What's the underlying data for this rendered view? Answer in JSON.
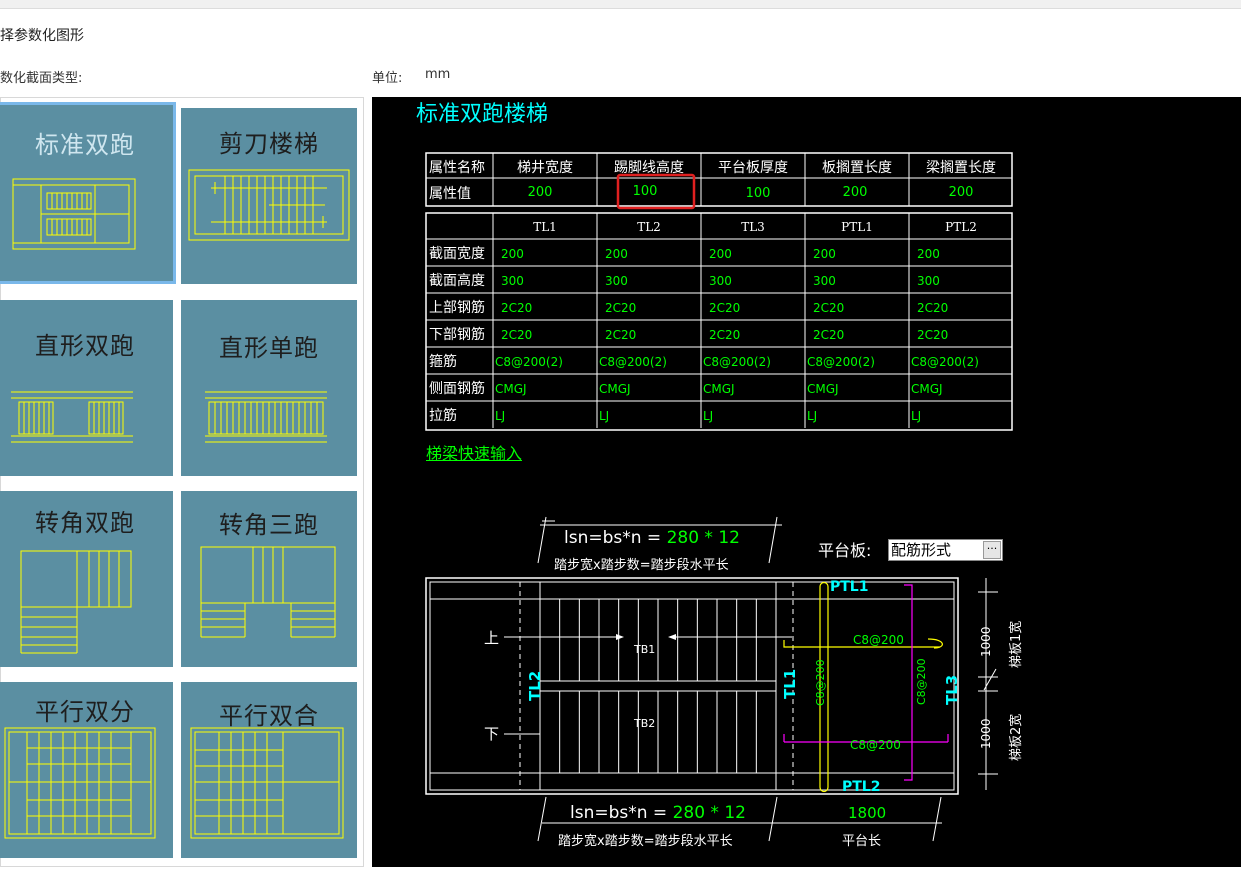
{
  "dialog": {
    "title": "择参数化图形",
    "section_label": "数化截面类型:",
    "unit_label": "单位:",
    "unit_value": "mm"
  },
  "types": [
    {
      "label": "标准双跑",
      "selected": true
    },
    {
      "label": "剪刀楼梯",
      "selected": false
    },
    {
      "label": "直形双跑",
      "selected": false
    },
    {
      "label": "直形单跑",
      "selected": false
    },
    {
      "label": "转角双跑",
      "selected": false
    },
    {
      "label": "转角三跑",
      "selected": false
    },
    {
      "label": "平行双分",
      "selected": false
    },
    {
      "label": "平行双合",
      "selected": false
    }
  ],
  "preview": {
    "title": "标准双跑楼梯",
    "params_table": {
      "row_headers": [
        "属性名称",
        "属性值"
      ],
      "columns": [
        "梯井宽度",
        "踢脚线高度",
        "平台板厚度",
        "板搁置长度",
        "梁搁置长度"
      ],
      "values": [
        "200",
        "100",
        "100",
        "200",
        "200"
      ],
      "highlighted_col": 1
    },
    "beam_table": {
      "columns": [
        "TL1",
        "TL2",
        "TL3",
        "PTL1",
        "PTL2"
      ],
      "rows": [
        {
          "label": "截面宽度",
          "values": [
            "200",
            "200",
            "200",
            "200",
            "200"
          ]
        },
        {
          "label": "截面高度",
          "values": [
            "300",
            "300",
            "300",
            "300",
            "300"
          ]
        },
        {
          "label": "上部钢筋",
          "values": [
            "2C20",
            "2C20",
            "2C20",
            "2C20",
            "2C20"
          ]
        },
        {
          "label": "下部钢筋",
          "values": [
            "2C20",
            "2C20",
            "2C20",
            "2C20",
            "2C20"
          ]
        },
        {
          "label": "箍筋",
          "values": [
            "C8@200(2)",
            "C8@200(2)",
            "C8@200(2)",
            "C8@200(2)",
            "C8@200(2)"
          ]
        },
        {
          "label": "侧面钢筋",
          "values": [
            "CMGJ",
            "CMGJ",
            "CMGJ",
            "CMGJ",
            "CMGJ"
          ]
        },
        {
          "label": "拉筋",
          "values": [
            "LJ",
            "LJ",
            "LJ",
            "LJ",
            "LJ"
          ]
        }
      ]
    },
    "quick_link": "梯梁快速输入",
    "formula_prefix": "lsn=bs*n = ",
    "formula_values": "280 * 12",
    "formula_caption": "踏步宽x踏步数=踏步段水平长",
    "platform_label": "平台板:",
    "platform_value": "配筋形式",
    "platform_button": "···",
    "plan": {
      "up_label": "上",
      "down_label": "下",
      "tb1": "TB1",
      "tb2": "TB2",
      "tl1": "TL1",
      "tl2": "TL2",
      "tl3": "TL3",
      "ptl1": "PTL1",
      "ptl2": "PTL2",
      "rebar_h1": "C8@200",
      "rebar_h2": "C8@200",
      "rebar_v1": "C8@200",
      "rebar_v2": "C8@200",
      "width1_value": "1000",
      "width1_label": "梯板1宽",
      "width2_value": "1000",
      "width2_label": "梯板2宽",
      "platform_length_value": "1800",
      "platform_length_label": "平台长"
    }
  },
  "colors": {
    "tile_bg": "#5b8fa2",
    "tile_line": "#ffff00",
    "preview_bg": "#000000",
    "cyan": "#00ffff",
    "green": "#00ff00",
    "magenta": "#ff00ff",
    "highlight_red": "#e02020"
  }
}
